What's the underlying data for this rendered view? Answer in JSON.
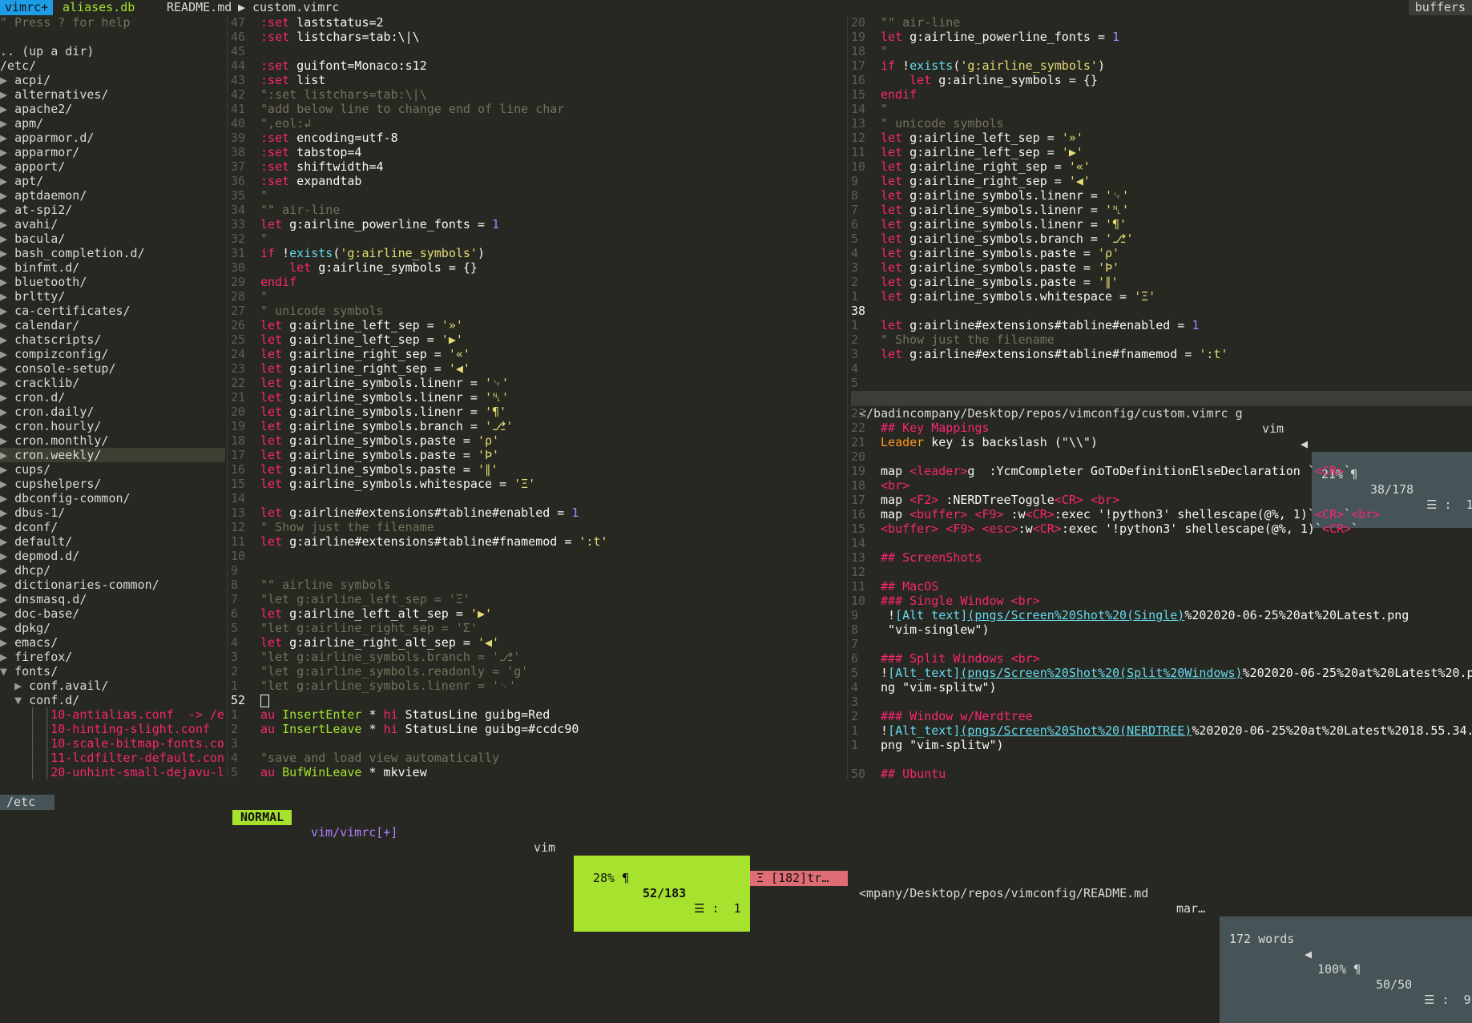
{
  "tabline": {
    "tabs": [
      "vimrc+",
      "aliases.db",
      "README.md",
      "custom.vimrc"
    ],
    "right_label": "buffers"
  },
  "tree": {
    "help": "\" Press ? for help",
    "up": ".. (up a dir)",
    "root": "/etc/",
    "dirs": [
      "acpi/",
      "alternatives/",
      "apache2/",
      "apm/",
      "apparmor.d/",
      "apparmor/",
      "apport/",
      "apt/",
      "aptdaemon/",
      "at-spi2/",
      "avahi/",
      "bacula/",
      "bash_completion.d/",
      "binfmt.d/",
      "bluetooth/",
      "brltty/",
      "ca-certificates/",
      "calendar/",
      "chatscripts/",
      "compizconfig/",
      "console-setup/",
      "cracklib/",
      "cron.d/",
      "cron.daily/",
      "cron.hourly/",
      "cron.monthly/",
      "cron.weekly/",
      "cups/",
      "cupshelpers/",
      "dbconfig-common/",
      "dbus-1/",
      "dconf/",
      "default/",
      "depmod.d/",
      "dhcp/",
      "dictionaries-common/",
      "dnsmasq.d/",
      "doc-base/",
      "dpkg/",
      "emacs/",
      "firefox/"
    ],
    "fonts": "fonts/",
    "conf_avail": "conf.avail/",
    "conf_d": "conf.d/",
    "files": [
      "10-antialias.conf  -> /e",
      "10-hinting-slight.conf",
      "10-scale-bitmap-fonts.co",
      "11-lcdfilter-default.con",
      "20-unhint-small-dejavu-l"
    ],
    "status": "/etc"
  },
  "middle": {
    "upper": [
      [
        "47",
        ":set laststatus=2"
      ],
      [
        "46",
        ":set listchars=tab:\\|\\"
      ],
      [
        "45",
        ""
      ],
      [
        "44",
        ":set guifont=Monaco:s12"
      ],
      [
        "43",
        ":set list"
      ],
      [
        "42",
        "\":set listchars=tab:\\|\\"
      ],
      [
        "41",
        "\"add below line to change end of line char"
      ],
      [
        "40",
        "\",eol:↲"
      ],
      [
        "39",
        ":set encoding=utf-8"
      ],
      [
        "38",
        ":set tabstop=4"
      ],
      [
        "37",
        ":set shiftwidth=4"
      ],
      [
        "36",
        ":set expandtab"
      ],
      [
        "35",
        "\""
      ],
      [
        "34",
        "\"\" air-line"
      ],
      [
        "33",
        "let g:airline_powerline_fonts = 1"
      ],
      [
        "32",
        "\""
      ],
      [
        "31",
        "if !exists('g:airline_symbols')"
      ],
      [
        "30",
        "    let g:airline_symbols = {}"
      ],
      [
        "29",
        "endif"
      ],
      [
        "28",
        "\""
      ],
      [
        "27",
        "\" unicode symbols"
      ],
      [
        "26",
        "let g:airline_left_sep = '»'"
      ],
      [
        "25",
        "let g:airline_left_sep = '▶'"
      ],
      [
        "24",
        "let g:airline_right_sep = '«'"
      ],
      [
        "23",
        "let g:airline_right_sep = '◀'"
      ],
      [
        "22",
        "let g:airline_symbols.linenr = '␊'"
      ],
      [
        "21",
        "let g:airline_symbols.linenr = '␤'"
      ],
      [
        "20",
        "let g:airline_symbols.linenr = '¶'"
      ],
      [
        "19",
        "let g:airline_symbols.branch = '⎇'"
      ],
      [
        "18",
        "let g:airline_symbols.paste = 'ρ'"
      ],
      [
        "17",
        "let g:airline_symbols.paste = 'Þ'"
      ],
      [
        "16",
        "let g:airline_symbols.paste = '∥'"
      ],
      [
        "15",
        "let g:airline_symbols.whitespace = 'Ξ'"
      ],
      [
        "14",
        ""
      ],
      [
        "13",
        "let g:airline#extensions#tabline#enabled = 1"
      ],
      [
        "12",
        "\" Show just the filename"
      ],
      [
        "11",
        "let g:airline#extensions#tabline#fnamemod = ':t'"
      ],
      [
        "10",
        ""
      ],
      [
        "9",
        ""
      ],
      [
        "8",
        "\"\" airline symbols"
      ],
      [
        "7",
        "\"let g:airline_left_sep = 'Ξ'"
      ],
      [
        "6",
        "let g:airline_left_alt_sep = '▶'"
      ],
      [
        "5",
        "\"let g:airline_right_sep = 'Σ'"
      ],
      [
        "4",
        "let g:airline_right_alt_sep = '◀'"
      ],
      [
        "3",
        "\"let g:airline_symbols.branch = '⎇'"
      ],
      [
        "2",
        "\"let g:airline_symbols.readonly = 'g'"
      ],
      [
        "1",
        "\"let g:airline_symbols.linenr = '␊'"
      ]
    ],
    "current_line": "52",
    "lower": [
      [
        "1",
        "au InsertEnter * hi StatusLine guibg=Red"
      ],
      [
        "2",
        "au InsertLeave * hi StatusLine guibg=#ccdc90"
      ],
      [
        "3",
        ""
      ],
      [
        "4",
        "\"save and load view automatically"
      ],
      [
        "5",
        "au BufWinLeave * mkview"
      ]
    ],
    "status": {
      "mode": "NORMAL",
      "file": "vim/vimrc[+]",
      "ft": "vim",
      "pct": "28% ¶",
      "pos": "52/183",
      "col": "☰ :  1",
      "ws": "Ξ [182]tr…"
    }
  },
  "right_top": {
    "upper": [
      [
        "20",
        "\"\" air-line"
      ],
      [
        "19",
        "let g:airline_powerline_fonts = 1"
      ],
      [
        "18",
        "\""
      ],
      [
        "17",
        "if !exists('g:airline_symbols')"
      ],
      [
        "16",
        "    let g:airline_symbols = {}"
      ],
      [
        "15",
        "endif"
      ],
      [
        "14",
        "\""
      ],
      [
        "13",
        "\" unicode symbols"
      ],
      [
        "12",
        "let g:airline_left_sep = '»'"
      ],
      [
        "11",
        "let g:airline_left_sep = '▶'"
      ],
      [
        "10",
        "let g:airline_right_sep = '«'"
      ],
      [
        "9",
        "let g:airline_right_sep = '◀'"
      ],
      [
        "8",
        "let g:airline_symbols.linenr = '␊'"
      ],
      [
        "7",
        "let g:airline_symbols.linenr = '␤'"
      ],
      [
        "6",
        "let g:airline_symbols.linenr = '¶'"
      ],
      [
        "5",
        "let g:airline_symbols.branch = '⎇'"
      ],
      [
        "4",
        "let g:airline_symbols.paste = 'ρ'"
      ],
      [
        "3",
        "let g:airline_symbols.paste = 'Þ'"
      ],
      [
        "2",
        "let g:airline_symbols.paste = '∥'"
      ],
      [
        "1",
        "let g:airline_symbols.whitespace = 'Ξ'"
      ]
    ],
    "current_line": "38",
    "lower": [
      [
        "1",
        "let g:airline#extensions#tabline#enabled = 1"
      ],
      [
        "2",
        "\" Show just the filename"
      ],
      [
        "3",
        "let g:airline#extensions#tabline#fnamemod = ':t'"
      ],
      [
        "4",
        ""
      ],
      [
        "5",
        ""
      ]
    ],
    "status": {
      "file": "</badincompany/Desktop/repos/vimconfig/custom.vimrc g",
      "ft": "vim",
      "pct": "21% ¶",
      "pos": "38/178",
      "col": "☰ :  1"
    }
  },
  "right_bottom": {
    "lines": [
      [
        "23",
        ""
      ],
      [
        "22",
        "## Key Mappings"
      ],
      [
        "21",
        "Leader key is backslash (\"\\\\\")"
      ],
      [
        "20",
        ""
      ],
      [
        "19",
        "map <leader>g  :YcmCompleter GoToDefinitionElseDeclaration `<CR>`"
      ],
      [
        "18",
        "<br>"
      ],
      [
        "17",
        "map <F2> :NERDTreeToggle<CR> <br>"
      ],
      [
        "16",
        "map <buffer> <F9> :w<CR>:exec '!python3' shellescape(@%, 1)`<CR>`<br>"
      ],
      [
        "15",
        "<buffer> <F9> <esc>:w<CR>:exec '!python3' shellescape(@%, 1)`<CR>`"
      ],
      [
        "14",
        ""
      ],
      [
        "13",
        "## ScreenShots"
      ],
      [
        "12",
        ""
      ],
      [
        "11",
        "## MacOS"
      ],
      [
        "10",
        "### Single Window <br>"
      ],
      [
        "9",
        " ![Alt text](pngs/Screen%20Shot%20(Single)%202020-06-25%20at%20Latest.png"
      ],
      [
        "8",
        " \"vim-singlew\")"
      ],
      [
        "7",
        ""
      ],
      [
        "6",
        "### Split Windows <br>"
      ],
      [
        "5",
        "![Alt_text](pngs/Screen%20Shot%20(Split%20Windows)%202020-06-25%20at%20Latest%20.p"
      ],
      [
        "4",
        "ng \"vim-splitw\")"
      ],
      [
        "3",
        ""
      ],
      [
        "2",
        "### Window w/Nerdtree"
      ],
      [
        "1",
        "![Alt_text](pngs/Screen%20Shot%20(NERDTREE)%202020-06-25%20at%20Latest%2018.55.34."
      ],
      [
        "1",
        "png \"vim-splitw\")"
      ],
      [
        "",
        ""
      ],
      [
        "50",
        "## Ubuntu"
      ]
    ],
    "status": {
      "file": "<mpany/Desktop/repos/vimconfig/README.md",
      "ft": "mar…",
      "words": "172 words",
      "pct": "100% ¶",
      "pos": "50/50",
      "col": "☰ :  9"
    }
  }
}
